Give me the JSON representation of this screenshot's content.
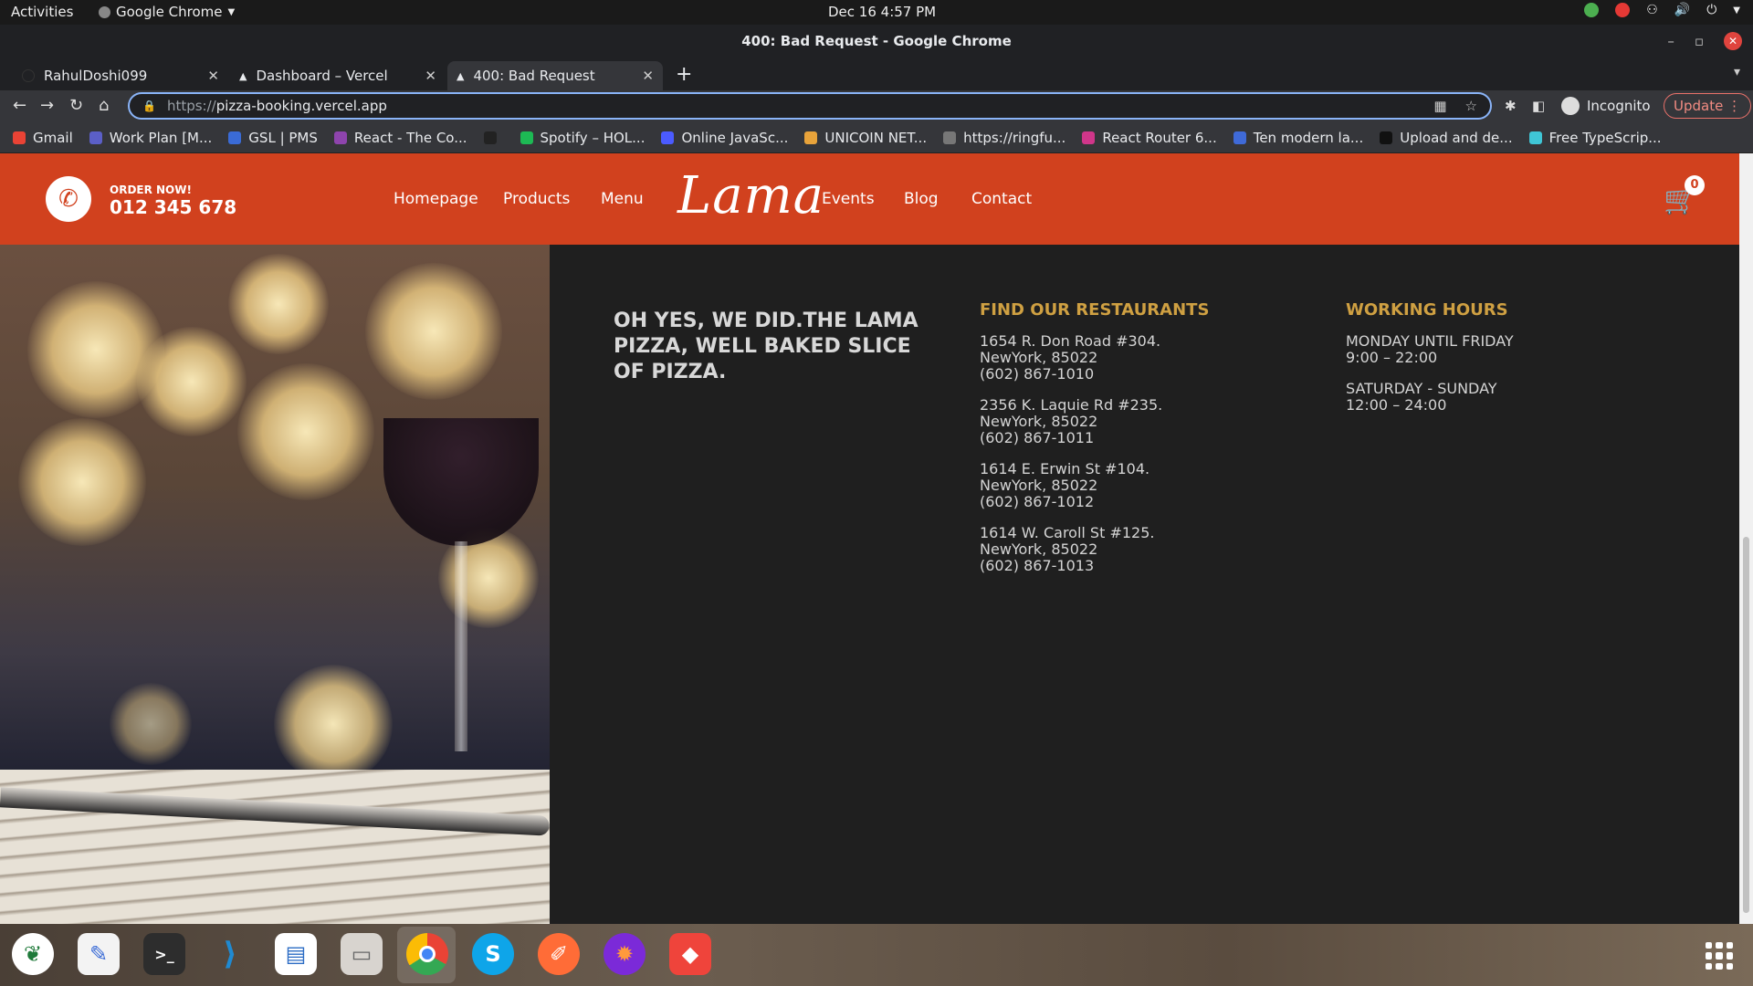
{
  "topbar": {
    "activities": "Activities",
    "app_name": "Google Chrome",
    "clock": "Dec 16  4:57 PM"
  },
  "window": {
    "title": "400: Bad Request - Google Chrome"
  },
  "tabs": [
    {
      "label": "RahulDoshi099"
    },
    {
      "label": "Dashboard – Vercel"
    },
    {
      "label": "400: Bad Request"
    }
  ],
  "address_bar": {
    "scheme": "https://",
    "host": "pizza-booking.vercel.app"
  },
  "profile": {
    "incognito_label": "Incognito",
    "update_label": "Update"
  },
  "bookmarks": [
    {
      "label": "Gmail",
      "color": "#ea4335"
    },
    {
      "label": "Work Plan [M...",
      "color": "#5b5fc7"
    },
    {
      "label": "GSL | PMS",
      "color": "#3a6bd6"
    },
    {
      "label": "React - The Co...",
      "color": "#8e44ad"
    },
    {
      "label": "",
      "color": "#222222"
    },
    {
      "label": "Spotify – HOL...",
      "color": "#1db954"
    },
    {
      "label": "Online JavaSc...",
      "color": "#4b5bff"
    },
    {
      "label": "UNICOIN NET...",
      "color": "#e8a33a"
    },
    {
      "label": "https://ringfu...",
      "color": "#777777"
    },
    {
      "label": "React Router 6...",
      "color": "#d0368a"
    },
    {
      "label": "Ten modern la...",
      "color": "#3f6ad8"
    },
    {
      "label": "Upload and de...",
      "color": "#111111"
    },
    {
      "label": "Free TypeScrip...",
      "color": "#3fc6d6"
    }
  ],
  "site": {
    "brand_color": "#d1411e",
    "order_label": "ORDER NOW!",
    "order_phone": "012 345 678",
    "nav": [
      "Homepage",
      "Products",
      "Menu",
      "Events",
      "Blog",
      "Contact"
    ],
    "logo": "Lama",
    "cart_count": "0"
  },
  "footer": {
    "headline": "OH YES, WE DID.THE LAMA PIZZA, WELL BAKED SLICE OF PIZZA.",
    "restaurants_title": "FIND OUR RESTAURANTS",
    "restaurants": [
      {
        "street": "1654 R. Don Road #304.",
        "city": "NewYork, 85022",
        "phone": "(602) 867-1010"
      },
      {
        "street": "2356 K. Laquie Rd #235.",
        "city": "NewYork, 85022",
        "phone": "(602) 867-1011"
      },
      {
        "street": "1614 E. Erwin St #104.",
        "city": "NewYork, 85022",
        "phone": "(602) 867-1012"
      },
      {
        "street": "1614 W. Caroll St #125.",
        "city": "NewYork, 85022",
        "phone": "(602) 867-1013"
      }
    ],
    "hours_title": "WORKING HOURS",
    "hours": [
      {
        "days": "MONDAY UNTIL FRIDAY",
        "time": "9:00 – 22:00"
      },
      {
        "days": "SATURDAY - SUNDAY",
        "time": "12:00 – 24:00"
      }
    ],
    "accent_color": "#cfa042"
  },
  "dock": [
    {
      "icon": "mongodb-compass-icon",
      "color": "#ffffff"
    },
    {
      "icon": "text-editor-icon",
      "color": "#f5f5f5"
    },
    {
      "icon": "terminal-icon",
      "color": "#2d2d2d"
    },
    {
      "icon": "vscode-icon",
      "color": "#1f8ad2"
    },
    {
      "icon": "libreoffice-writer-icon",
      "color": "#2a6bc4"
    },
    {
      "icon": "files-icon",
      "color": "#d8d4cf"
    },
    {
      "icon": "chrome-icon",
      "color": "#ffffff"
    },
    {
      "icon": "skype-icon",
      "color": "#0ea5e9"
    },
    {
      "icon": "postman-icon",
      "color": "#ff6c37"
    },
    {
      "icon": "firefox-dev-icon",
      "color": "#7b2ad8"
    },
    {
      "icon": "anydesk-icon",
      "color": "#ef443b"
    }
  ]
}
